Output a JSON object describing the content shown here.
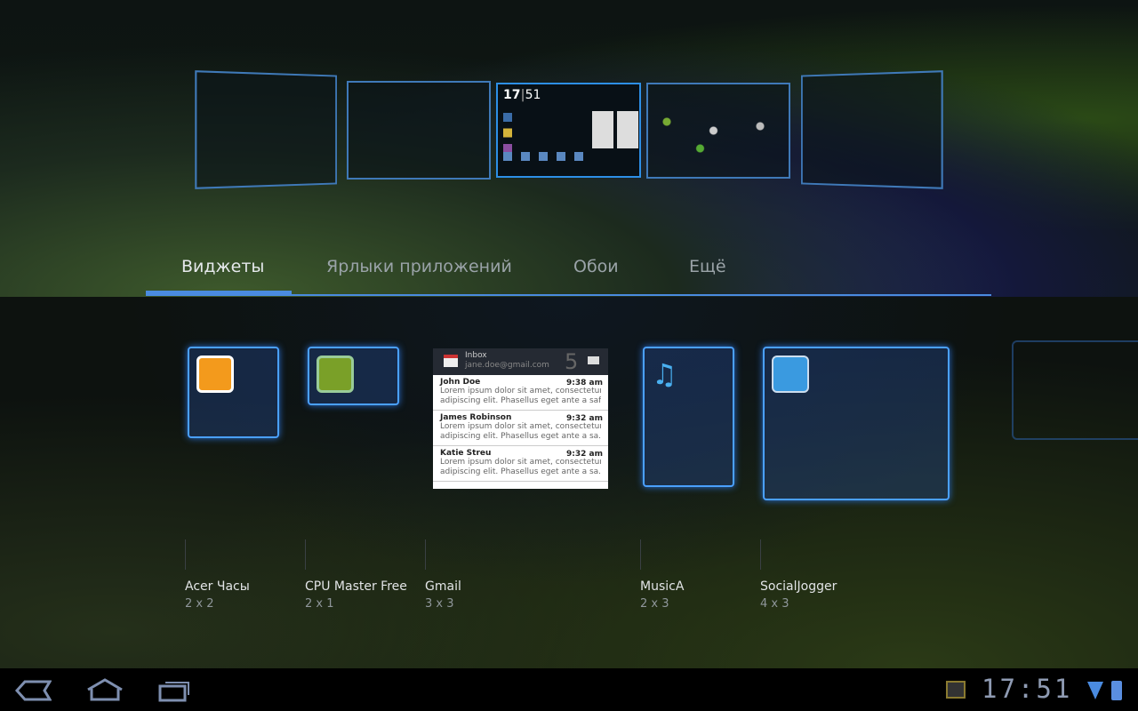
{
  "tabs": [
    {
      "label": "Виджеты"
    },
    {
      "label": "Ярлыки приложений"
    },
    {
      "label": "Обои"
    },
    {
      "label": "Ещё"
    }
  ],
  "preview": {
    "clock": "17",
    "clock_min": "51"
  },
  "widgets": [
    {
      "name": "Acer Часы",
      "size": "2 x 2"
    },
    {
      "name": "CPU Master Free",
      "size": "2 x 1"
    },
    {
      "name": "Gmail",
      "size": "3 x 3"
    },
    {
      "name": "MusicA",
      "size": "2 x 3"
    },
    {
      "name": "SocialJogger",
      "size": "4 x 3"
    }
  ],
  "gmail": {
    "title": "Inbox",
    "account": "jane.doe@gmail.com",
    "count": "5",
    "messages": [
      {
        "from": "John Doe",
        "time": "9:38 am",
        "line1": "Lorem ipsum dolor sit amet, consectetursdfs",
        "line2": "adipiscing elit. Phasellus eget ante a safsda..."
      },
      {
        "from": "James Robinson",
        "time": "9:32 am",
        "line1": "Lorem ipsum dolor sit amet, consectetur",
        "line2": "adipiscing elit. Phasellus eget ante a sa..."
      },
      {
        "from": "Katie Streu",
        "time": "9:32 am",
        "line1": "Lorem ipsum dolor sit amet, consectetur",
        "line2": "adipiscing elit. Phasellus eget ante a sa..."
      }
    ]
  },
  "status": {
    "time": "17:51"
  },
  "colors": {
    "accent": "#4a8be0"
  }
}
